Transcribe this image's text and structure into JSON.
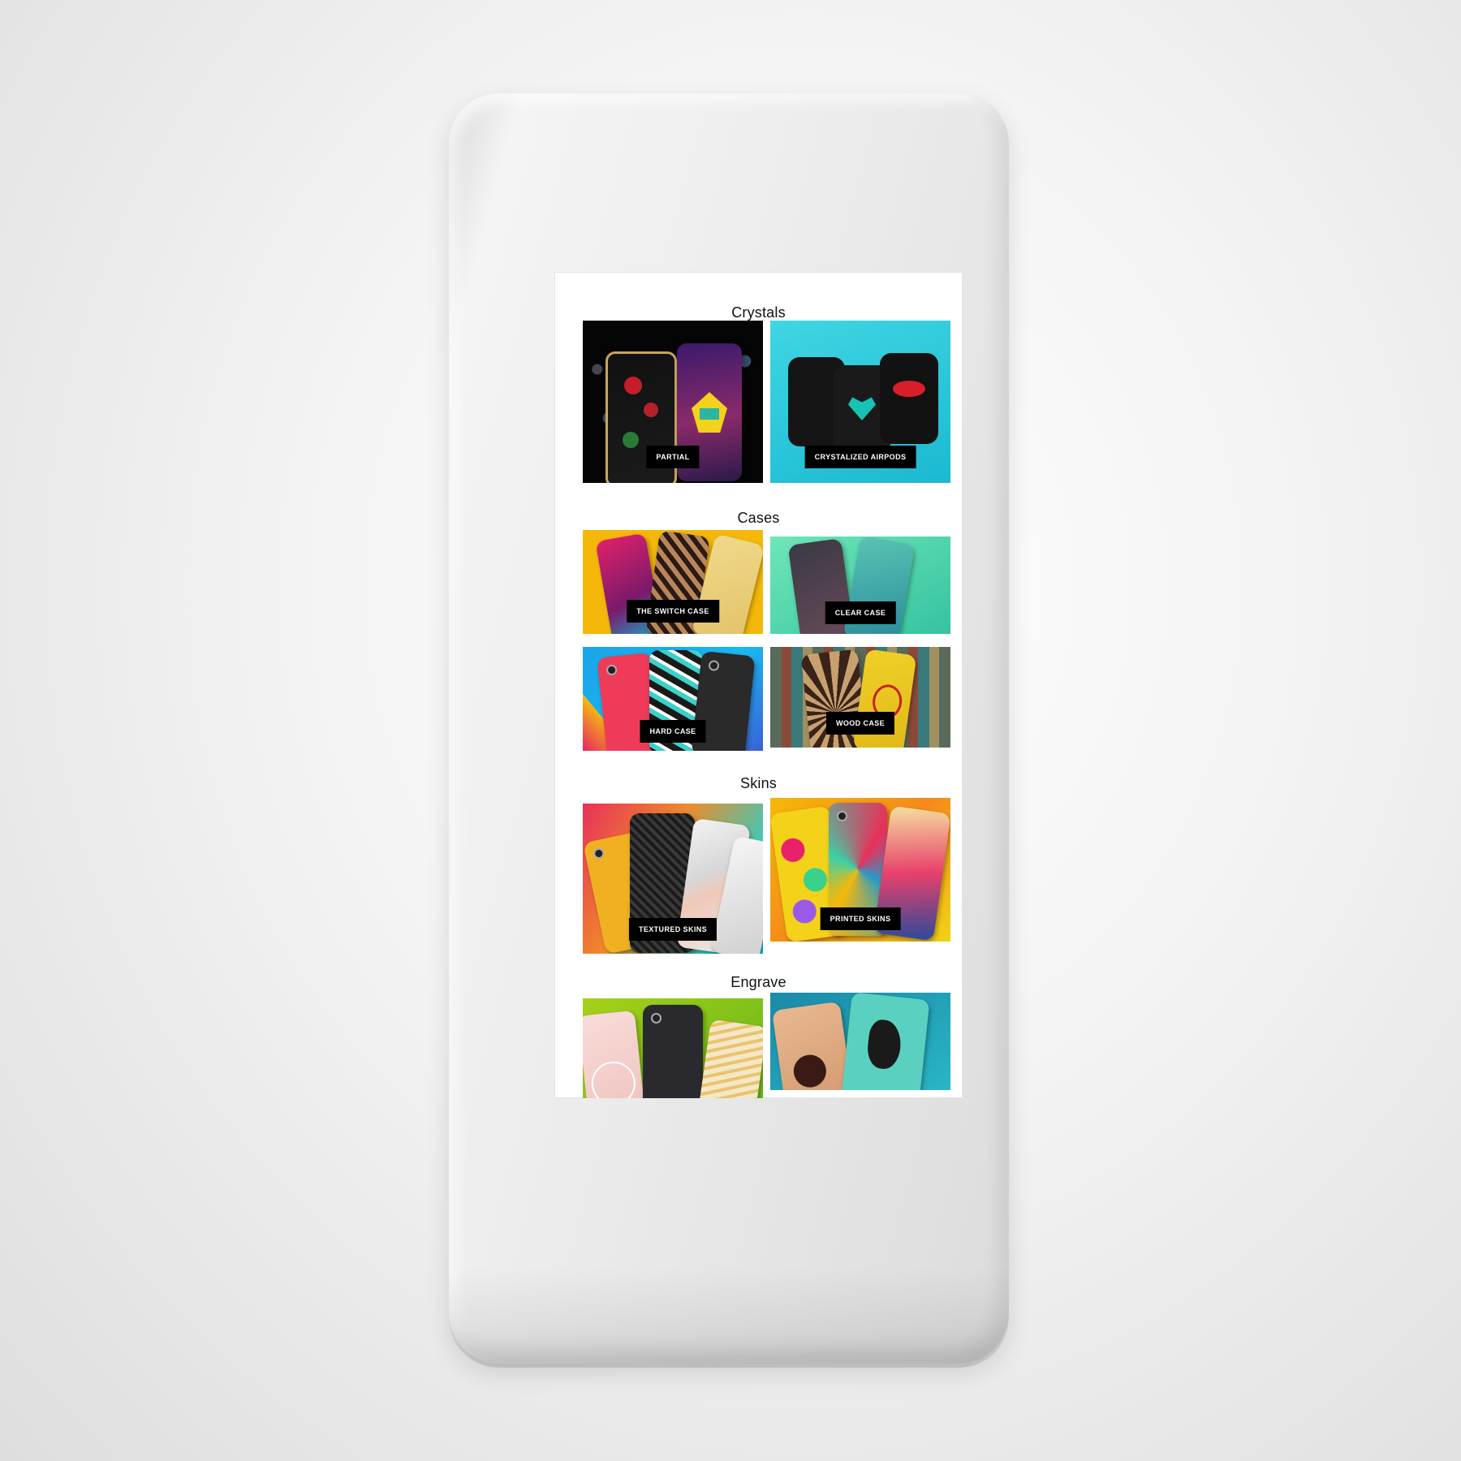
{
  "sections": {
    "crystals": {
      "title": "Crystals"
    },
    "cases": {
      "title": "Cases"
    },
    "skins": {
      "title": "Skins"
    },
    "engrave": {
      "title": "Engrave"
    }
  },
  "tiles": {
    "partial": "PARTIAL",
    "crystallized_airpods": "CRYSTALIZED AIRPODS",
    "switch_case": "THE SWITCH CASE",
    "clear_case": "CLEAR CASE",
    "hard_case": "HARD CASE",
    "wood_case": "WOOD CASE",
    "textured_skins": "TEXTURED SKINS",
    "printed_skins": "PRINTED SKINS"
  },
  "colors": {
    "screen_bg": "#ffffff",
    "label_bg": "#000000",
    "label_text": "#ffffff"
  }
}
